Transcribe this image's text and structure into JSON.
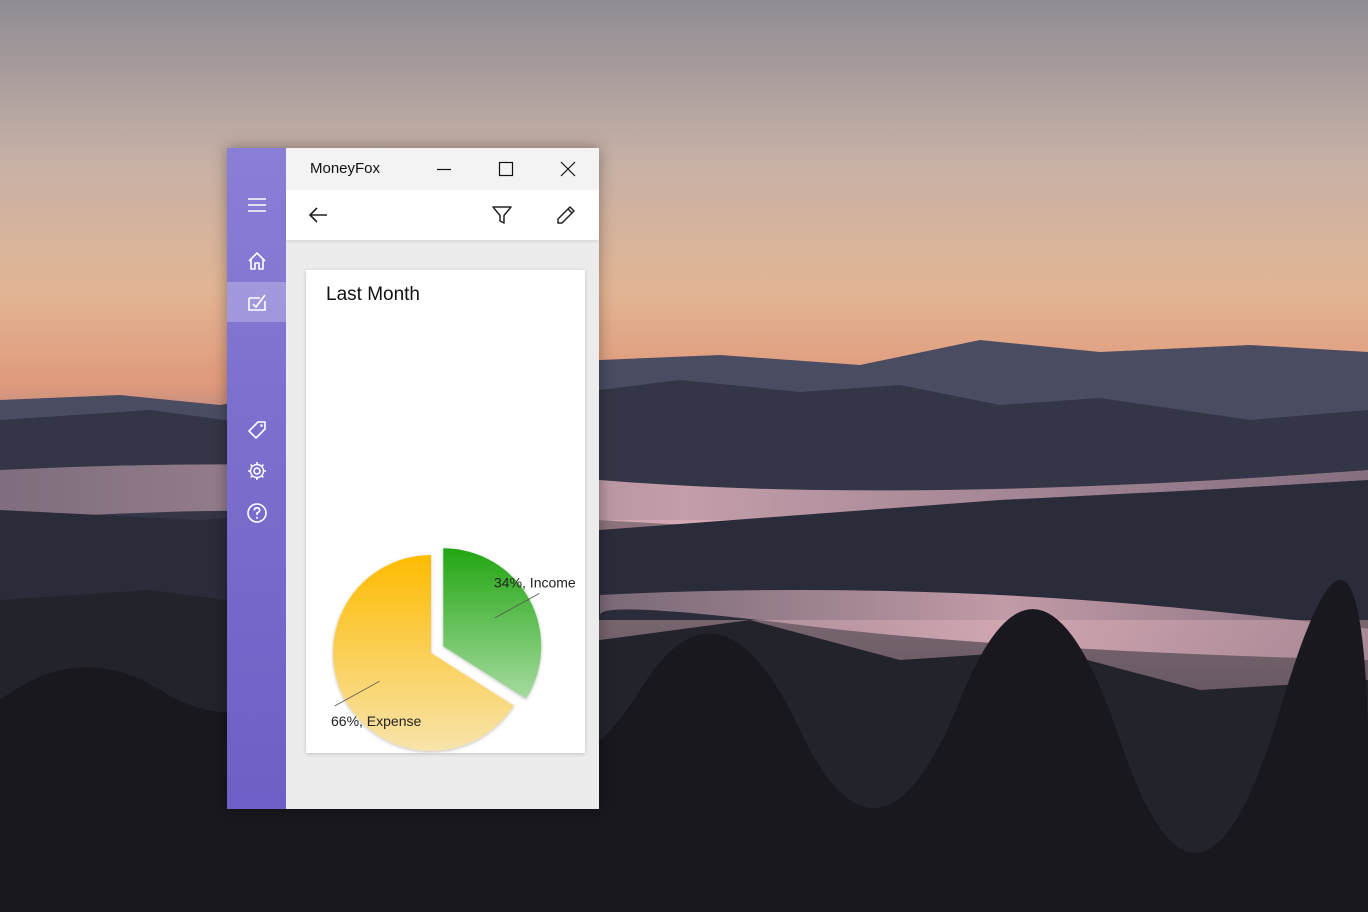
{
  "window": {
    "title": "MoneyFox"
  },
  "icons": {
    "menu": "hamburger-menu-icon",
    "home": "home-icon",
    "statistics": "statistics-icon",
    "categories": "tag-icon",
    "settings": "gear-icon",
    "about": "help-icon",
    "back": "back-arrow-icon",
    "filter": "filter-icon",
    "edit": "pencil-icon",
    "minimize": "minimize-icon",
    "maximize": "maximize-icon",
    "close": "close-icon"
  },
  "colors": {
    "rail": "#7a6ece",
    "income": "#22a612",
    "income_light": "#a6dba0",
    "expense": "#ffbb00",
    "expense_light": "#f7e4ac"
  },
  "chart_data": {
    "type": "pie",
    "title": "Last Month",
    "slices": [
      {
        "name": "Income",
        "percent": 34,
        "label": "34%, Income"
      },
      {
        "name": "Expense",
        "percent": 66,
        "label": "66%, Expense"
      }
    ],
    "exploded": true,
    "legend": false
  }
}
